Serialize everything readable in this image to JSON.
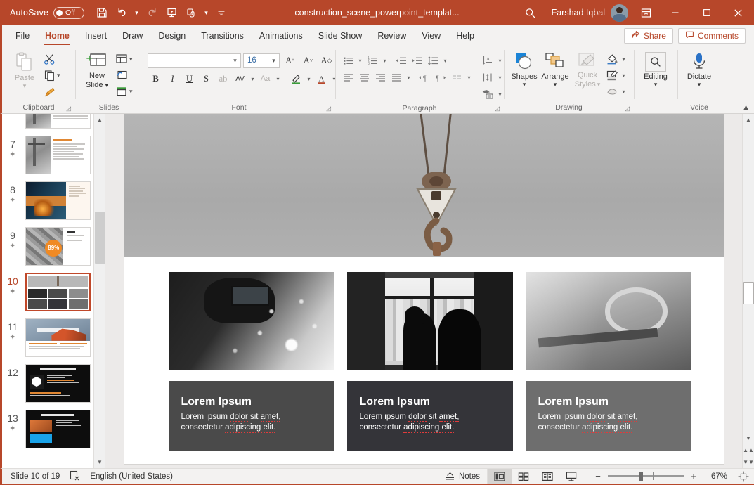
{
  "titlebar": {
    "autosave_label": "AutoSave",
    "autosave_state": "Off",
    "document_title": "construction_scene_powerpoint_templat...",
    "user_name": "Farshad Iqbal",
    "icons": {
      "save": "save-icon",
      "undo": "undo-icon",
      "redo": "redo-icon",
      "present": "start-presentation-icon",
      "touch": "touch-mode-icon",
      "more": "customize-quick-access-icon",
      "search": "search-icon",
      "ribbon_display": "ribbon-display-options-icon",
      "minimize": "minimize-icon",
      "maximize": "maximize-icon",
      "close": "close-icon"
    }
  },
  "menubar": {
    "tabs": [
      {
        "label": "File",
        "active": false
      },
      {
        "label": "Home",
        "active": true
      },
      {
        "label": "Insert",
        "active": false
      },
      {
        "label": "Draw",
        "active": false
      },
      {
        "label": "Design",
        "active": false
      },
      {
        "label": "Transitions",
        "active": false
      },
      {
        "label": "Animations",
        "active": false
      },
      {
        "label": "Slide Show",
        "active": false
      },
      {
        "label": "Review",
        "active": false
      },
      {
        "label": "View",
        "active": false
      },
      {
        "label": "Help",
        "active": false
      }
    ],
    "share_label": "Share",
    "comments_label": "Comments"
  },
  "ribbon": {
    "groups": [
      {
        "name": "Clipboard",
        "label": "Clipboard"
      },
      {
        "name": "Slides",
        "label": "Slides"
      },
      {
        "name": "Font",
        "label": "Font"
      },
      {
        "name": "Paragraph",
        "label": "Paragraph"
      },
      {
        "name": "Drawing",
        "label": "Drawing"
      },
      {
        "name": "Voice",
        "label": "Voice"
      }
    ],
    "clipboard": {
      "paste_label": "Paste",
      "cut_label": "Cut",
      "copy_label": "Copy",
      "format_painter_label": "Format Painter"
    },
    "slides": {
      "new_slide_line1": "New",
      "new_slide_line2": "Slide",
      "layout_label": "Layout",
      "reset_label": "Reset",
      "section_label": "Section"
    },
    "font": {
      "font_name_value": "",
      "font_name_placeholder": "",
      "font_size_value": "16",
      "bold": "B",
      "italic": "I",
      "underline": "U",
      "shadow": "S",
      "strikethrough": "ab",
      "character_spacing": "AV",
      "change_case": "Aa",
      "increase_size": "A",
      "decrease_size": "A",
      "clear_formatting": "A"
    },
    "drawing": {
      "shapes_label": "Shapes",
      "arrange_label": "Arrange",
      "quick_styles_line1": "Quick",
      "quick_styles_line2": "Styles",
      "shape_fill_label": "Shape Fill",
      "shape_outline_label": "Shape Outline",
      "shape_effects_label": "Shape Effects"
    },
    "editing": {
      "editing_label": "Editing"
    },
    "voice": {
      "dictate_label": "Dictate"
    }
  },
  "thumbnails": [
    {
      "number": "7",
      "has_animation": true,
      "selected": false,
      "style": "t7"
    },
    {
      "number": "8",
      "has_animation": true,
      "selected": false,
      "style": "t8"
    },
    {
      "number": "9",
      "has_animation": true,
      "selected": false,
      "style": "t9"
    },
    {
      "number": "10",
      "has_animation": true,
      "selected": true,
      "style": "t10"
    },
    {
      "number": "11",
      "has_animation": true,
      "selected": false,
      "style": "t11",
      "title": "What We Do"
    },
    {
      "number": "12",
      "has_animation": false,
      "selected": false,
      "style": "t12",
      "title": "Replacing the Icons in this Template"
    },
    {
      "number": "13",
      "has_animation": true,
      "selected": false,
      "style": "t13",
      "title": "Replacing the Icons in this Template"
    }
  ],
  "slide": {
    "photos": [
      {
        "alt": "welder-with-sparks-photo"
      },
      {
        "alt": "two-workers-silhouette-window-photo"
      },
      {
        "alt": "circular-saw-workbench-photo"
      }
    ],
    "cards": [
      {
        "heading": "Lorem Ipsum",
        "line1_a": "Lorem ipsum ",
        "line1_b": "dolor",
        "line1_c": " sit ",
        "line1_d": "amet,",
        "line2_a": "consectetur ",
        "line2_b": "adipiscing elit.",
        "bg": "#4a4a4a"
      },
      {
        "heading": "Lorem Ipsum",
        "line1_a": "Lorem ipsum ",
        "line1_b": "dolor",
        "line1_c": " sit ",
        "line1_d": "amet,",
        "line2_a": "consectetur ",
        "line2_b": "adipiscing elit.",
        "bg": "#343439"
      },
      {
        "heading": "Lorem Ipsum",
        "line1_a": "Lorem ipsum ",
        "line1_b": "dolor",
        "line1_c": " sit ",
        "line1_d": "amet,",
        "line2_a": "consectetur ",
        "line2_b": "adipiscing elit.",
        "bg": "#6e6e6e"
      }
    ],
    "banner_alt": "crane-hook-banner-image"
  },
  "statusbar": {
    "slide_indicator": "Slide 10 of 19",
    "accessibility_icon": "accessibility-checker-icon",
    "language": "English (United States)",
    "notes_label": "Notes",
    "views": [
      {
        "name": "normal-view",
        "active": true
      },
      {
        "name": "slide-sorter-view",
        "active": false
      },
      {
        "name": "reading-view",
        "active": false
      },
      {
        "name": "slide-show-view",
        "active": false
      }
    ],
    "zoom_out": "−",
    "zoom_in": "+",
    "zoom_level": "67%",
    "fit_icon": "fit-slide-to-window-icon"
  },
  "colors": {
    "brand": "#b7472a",
    "ribbon_bg": "#f3f2f1",
    "selected_thumb_border": "#c0482a",
    "spellcheck_underline": "#e03b3b"
  }
}
